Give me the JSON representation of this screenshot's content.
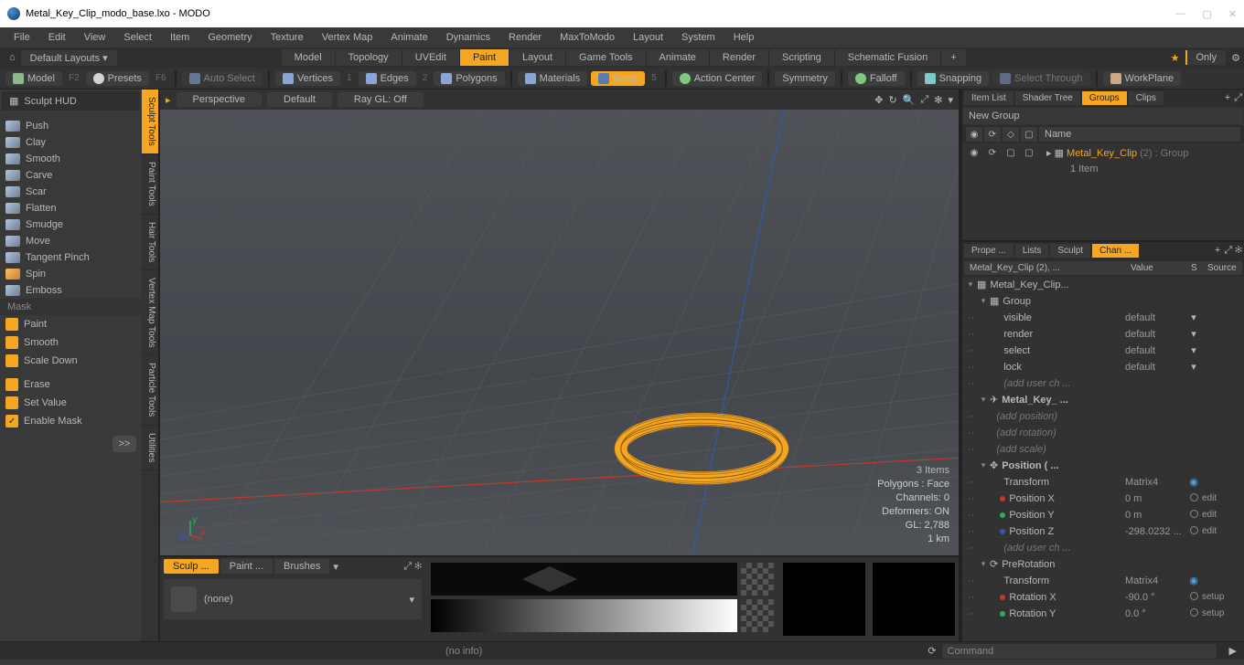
{
  "title": "Metal_Key_Clip_modo_base.lxo - MODO",
  "menu": [
    "File",
    "Edit",
    "View",
    "Select",
    "Item",
    "Geometry",
    "Texture",
    "Vertex Map",
    "Animate",
    "Dynamics",
    "Render",
    "MaxToModo",
    "Layout",
    "System",
    "Help"
  ],
  "layout_dropdown": "Default Layouts ▾",
  "layout_tabs": [
    "Model",
    "Topology",
    "UVEdit",
    "Paint",
    "Layout",
    "Game Tools",
    "Animate",
    "Render",
    "Scripting",
    "Schematic Fusion"
  ],
  "layout_active": "Paint",
  "only": "Only",
  "comp": {
    "model": "Model",
    "f2": "F2",
    "presets": "Presets",
    "f6": "F6",
    "autosel": "Auto Select",
    "vertices": "Vertices",
    "v1": "1",
    "edges": "Edges",
    "v2": "2",
    "polygons": "Polygons",
    "materials": "Materials",
    "items": "Items",
    "v5": "5",
    "action": "Action Center",
    "symmetry": "Symmetry",
    "falloff": "Falloff",
    "snapping": "Snapping",
    "selthru": "Select Through",
    "workplane": "WorkPlane"
  },
  "sculpt_hud": "Sculpt HUD",
  "tools": [
    "Push",
    "Clay",
    "Smooth",
    "Carve",
    "Scar",
    "Flatten",
    "Smudge",
    "Move",
    "Tangent Pinch",
    "Spin",
    "Emboss"
  ],
  "mask_hdr": "Mask",
  "mask_items": [
    "Paint",
    "Smooth",
    "Scale Down"
  ],
  "erase": "Erase",
  "setval": "Set Value",
  "enablemask": "Enable Mask",
  "fwd": ">>",
  "vtabs": [
    "Sculpt Tools",
    "Paint Tools",
    "Hair Tools",
    "Vertex Map Tools",
    "Particle Tools",
    "Utilities"
  ],
  "vp": {
    "persp": "Perspective",
    "def": "Default",
    "raygl": "Ray GL: Off"
  },
  "vpstats": {
    "items": "3 Items",
    "poly": "Polygons : Face",
    "chan": "Channels: 0",
    "def": "Deformers: ON",
    "gl": "GL: 2,788",
    "dist": "1 km"
  },
  "btabs": [
    "Sculp ...",
    "Paint ...",
    "Brushes"
  ],
  "none": "(none)",
  "rt1": [
    "Item List",
    "Shader Tree",
    "Groups",
    "Clips"
  ],
  "rt1_act": "Groups",
  "newgrp": "New Group",
  "ghdr_name": "Name",
  "gitem": {
    "name": "Metal_Key_Clip",
    "suffix": " (2) : Group",
    "sub": "1 Item"
  },
  "rt2": [
    "Prope ...",
    "Lists",
    "Sculpt",
    "Chan ..."
  ],
  "rt2_act": "Chan ...",
  "chdr": {
    "n": "Metal_Key_Clip (2), ...",
    "v": "Value",
    "s": "S",
    "src": "Source"
  },
  "ch": {
    "root": "Metal_Key_Clip...",
    "group": "Group",
    "visible": "visible",
    "render": "render",
    "select": "select",
    "lock": "lock",
    "default": "default",
    "addch": "(add user ch ...",
    "mk": "Metal_Key_ ...",
    "addpos": "(add position)",
    "addrot": "(add rotation)",
    "addscl": "(add scale)",
    "pos": "Position ( ...",
    "transform": "Transform",
    "matrix": "Matrix4",
    "px": "Position X",
    "py": "Position Y",
    "pz": "Position Z",
    "m0": "0 m",
    "pzv": "-298.0232 ...",
    "edit": "edit",
    "prerot": "PreRotation",
    "rx": "Rotation X",
    "ry": "Rotation Y",
    "rxv": "-90.0 °",
    "ryv": "0.0 °",
    "setup": "setup"
  },
  "status": {
    "info": "(no info)",
    "cmd": "Command"
  }
}
